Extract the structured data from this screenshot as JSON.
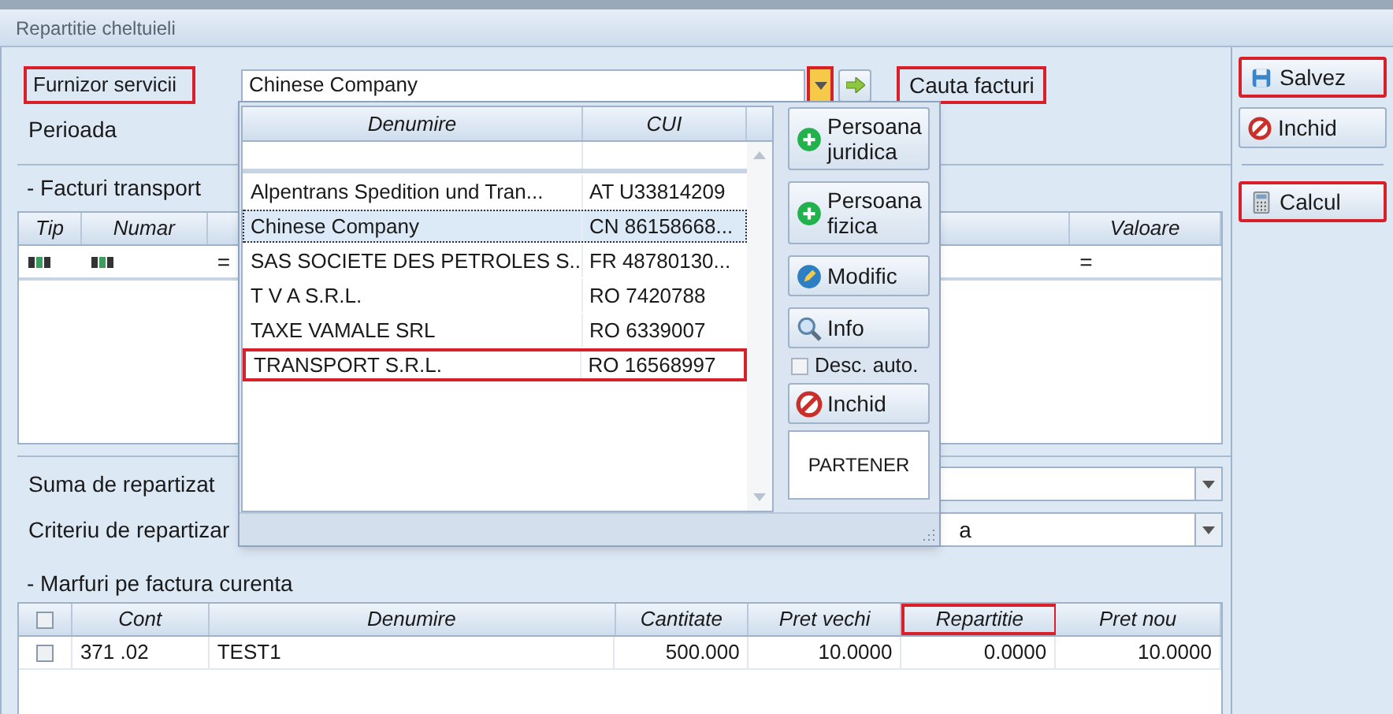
{
  "window": {
    "title": "Repartitie cheltuieli"
  },
  "supplier": {
    "label": "Furnizor servicii",
    "label_highlighted": true,
    "value": "Chinese Company",
    "dropdown_highlighted": true,
    "search_label": "Cauta facturi",
    "search_highlighted": true
  },
  "period": {
    "label": "Perioada"
  },
  "transport_invoices": {
    "title": "- Facturi transport",
    "columns": [
      "Tip",
      "Numar",
      "Valoare"
    ],
    "rows": [
      {
        "cells": [
          {
            "kind": "icon"
          },
          {
            "kind": "icon"
          },
          {
            "kind": "text",
            "text": "="
          },
          {
            "kind": "text",
            "text": "="
          }
        ]
      }
    ]
  },
  "distribution": {
    "amount_label": "Suma de repartizat",
    "criterion_label": "Criteriu de repartizar",
    "criterion_value": "a"
  },
  "goods": {
    "title": "- Marfuri pe factura curenta",
    "header_checked": false,
    "columns": [
      {
        "label": "Cont",
        "highlighted": false
      },
      {
        "label": "Denumire",
        "highlighted": false
      },
      {
        "label": "Cantitate",
        "highlighted": false
      },
      {
        "label": "Pret vechi",
        "highlighted": false
      },
      {
        "label": "Repartitie",
        "highlighted": true
      },
      {
        "label": "Pret nou",
        "highlighted": false
      }
    ],
    "rows": [
      {
        "checked": false,
        "cells": [
          "371 .02",
          "TEST1",
          "500.000",
          "10.0000",
          "0.0000",
          "10.0000"
        ]
      }
    ]
  },
  "actions": [
    {
      "kind": "button",
      "label": "Salvez",
      "highlighted": true
    },
    {
      "kind": "button",
      "label": "Inchid",
      "highlighted": false
    },
    {
      "kind": "divider"
    },
    {
      "kind": "button",
      "label": "Calcul",
      "highlighted": true
    }
  ],
  "partner_popup": {
    "columns": [
      "Denumire",
      "CUI"
    ],
    "rows": [
      {
        "name": "Alpentrans Spedition und Tran...",
        "cui": "AT U33814209",
        "selected": false,
        "highlighted": false
      },
      {
        "name": "Chinese Company",
        "cui": "CN 86158668...",
        "selected": true,
        "highlighted": false
      },
      {
        "name": "SAS SOCIETE DES PETROLES S...",
        "cui": "FR 48780130...",
        "selected": false,
        "highlighted": false
      },
      {
        "name": "T V A S.R.L.",
        "cui": "RO 7420788",
        "selected": false,
        "highlighted": false
      },
      {
        "name": "TAXE VAMALE SRL",
        "cui": "RO 6339007",
        "selected": false,
        "highlighted": false
      },
      {
        "name": "TRANSPORT S.R.L.",
        "cui": "RO 16568997",
        "selected": false,
        "highlighted": true
      }
    ],
    "buttons": [
      {
        "kind": "button",
        "label": "Persoana juridica"
      },
      {
        "kind": "button",
        "label": "Persoana fizica"
      },
      {
        "kind": "button",
        "label": "Modific"
      },
      {
        "kind": "button",
        "label": "Info"
      },
      {
        "kind": "checkbox",
        "label": "Desc. auto.",
        "checked": false
      },
      {
        "kind": "button",
        "label": "Inchid"
      },
      {
        "kind": "plain",
        "label": "PARTENER"
      }
    ]
  }
}
